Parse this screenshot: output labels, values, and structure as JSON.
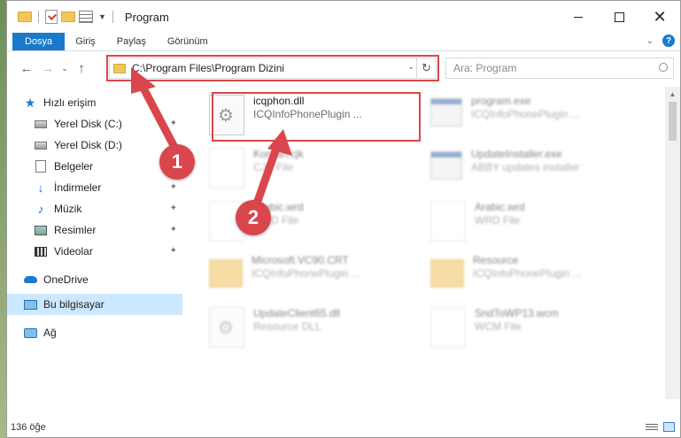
{
  "window": {
    "title": "Program"
  },
  "quick_access_toolbar": {
    "icons": [
      "folder-icon",
      "checkmark-icon",
      "properties-icon",
      "customize-dropdown-icon"
    ]
  },
  "ribbon": {
    "tabs": [
      "Dosya",
      "Giriş",
      "Paylaş",
      "Görünüm"
    ],
    "help_label": "?"
  },
  "address_bar": {
    "path": "C:\\Program Files\\Program Dizini"
  },
  "search": {
    "placeholder": "Ara: Program"
  },
  "sidebar": {
    "items": [
      {
        "label": "Hızlı erişim",
        "icon": "star-icon"
      },
      {
        "label": "Yerel Disk (C:)",
        "icon": "drive-icon",
        "pinned": true
      },
      {
        "label": "Yerel Disk (D:)",
        "icon": "drive-icon",
        "pinned": true
      },
      {
        "label": "Belgeler",
        "icon": "documents-icon",
        "pinned": false
      },
      {
        "label": "İndirmeler",
        "icon": "download-icon",
        "pinned": true
      },
      {
        "label": "Müzik",
        "icon": "music-icon",
        "pinned": true
      },
      {
        "label": "Resimler",
        "icon": "pictures-icon",
        "pinned": true
      },
      {
        "label": "Videolar",
        "icon": "videos-icon",
        "pinned": true
      },
      {
        "label": "OneDrive",
        "icon": "cloud-icon"
      },
      {
        "label": "Bu bilgisayar",
        "icon": "computer-icon",
        "selected": true
      },
      {
        "label": "Ağ",
        "icon": "network-icon"
      }
    ]
  },
  "files": [
    {
      "name": "icqphon.dll",
      "subtitle": "ICQInfoPhonePlugin ...",
      "icon": "dll-icon"
    },
    {
      "name": "program.exe",
      "subtitle": "ICQInfoPhonePlugin ...",
      "icon": "exe-icon"
    },
    {
      "name": "Korean.cjk",
      "subtitle": "CJK File",
      "icon": "file-icon"
    },
    {
      "name": "UpdateInstaller.exe",
      "subtitle": "ABBY updates installer",
      "icon": "exe-icon"
    },
    {
      "name": "Arabic.wrd",
      "subtitle": "WRD File",
      "icon": "file-icon"
    },
    {
      "name": "Arabic.wrd",
      "subtitle": "WRD File",
      "icon": "file-icon"
    },
    {
      "name": "Microsoft.VC90.CRT",
      "subtitle": "ICQInfoPhonePlugin ...",
      "icon": "folder-icon"
    },
    {
      "name": "Resource",
      "subtitle": "ICQInfoPhonePlugin ...",
      "icon": "folder-icon"
    },
    {
      "name": "UpdateClient65.dll",
      "subtitle": "Resource DLL",
      "icon": "dll-icon"
    },
    {
      "name": "SndToWP13.wcm",
      "subtitle": "WCM File",
      "icon": "file-icon"
    }
  ],
  "status": {
    "item_count": "136 öğe"
  },
  "annotations": {
    "step1": "1",
    "step2": "2"
  },
  "colors": {
    "accent": "#1979ca",
    "annotation": "#d9464b",
    "selection": "#cce8ff"
  }
}
